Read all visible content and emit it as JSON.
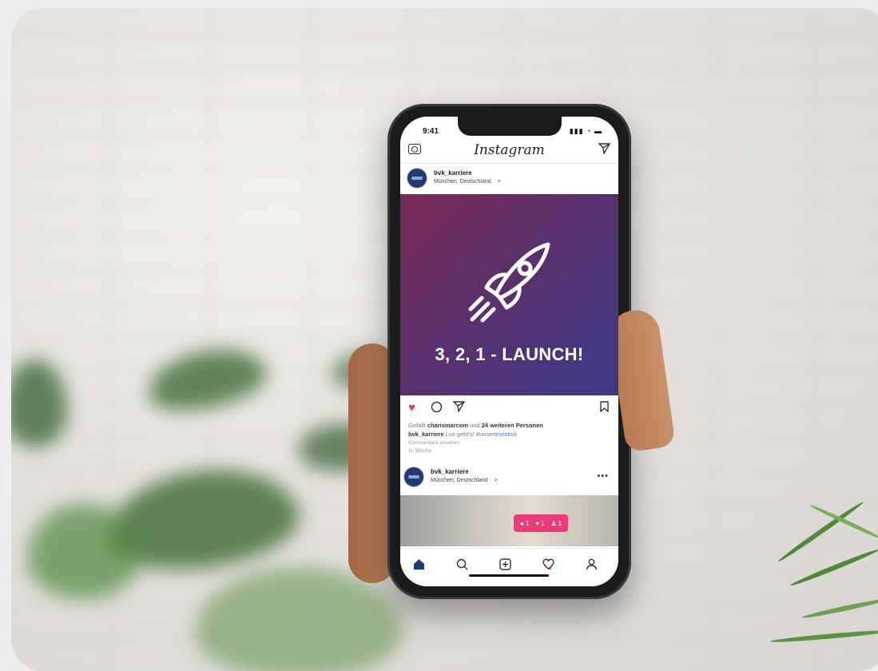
{
  "status": {
    "time": "9:41",
    "icons": "▮▮▮ ◔ ▬"
  },
  "header": {
    "logo": "Instagram"
  },
  "post1": {
    "username": "bvk_karriere",
    "location": "München, Deutschland",
    "location_arrow": ">",
    "image_text": "3, 2, 1 - LAUNCH!",
    "likes_prefix": "Gefällt",
    "likes_user": "charismarcom",
    "likes_mid": "und",
    "likes_rest": "24 weiteren Personen",
    "caption_user": "bvk_karriere",
    "caption_text": "Los geht's!",
    "caption_tag": "#unserteambvk",
    "sub1": "Kommentare ansehen",
    "sub2": "1t. Woche"
  },
  "post2": {
    "username": "bvk_karriere",
    "location": "München, Deutschland",
    "location_arrow": ">",
    "more": "•••"
  },
  "notification": {
    "comments": "1",
    "likes": "1",
    "followers": "1"
  },
  "colors": {
    "accent": "#e6396b",
    "gradient_start": "#7a2a55",
    "gradient_end": "#3b3a86"
  }
}
